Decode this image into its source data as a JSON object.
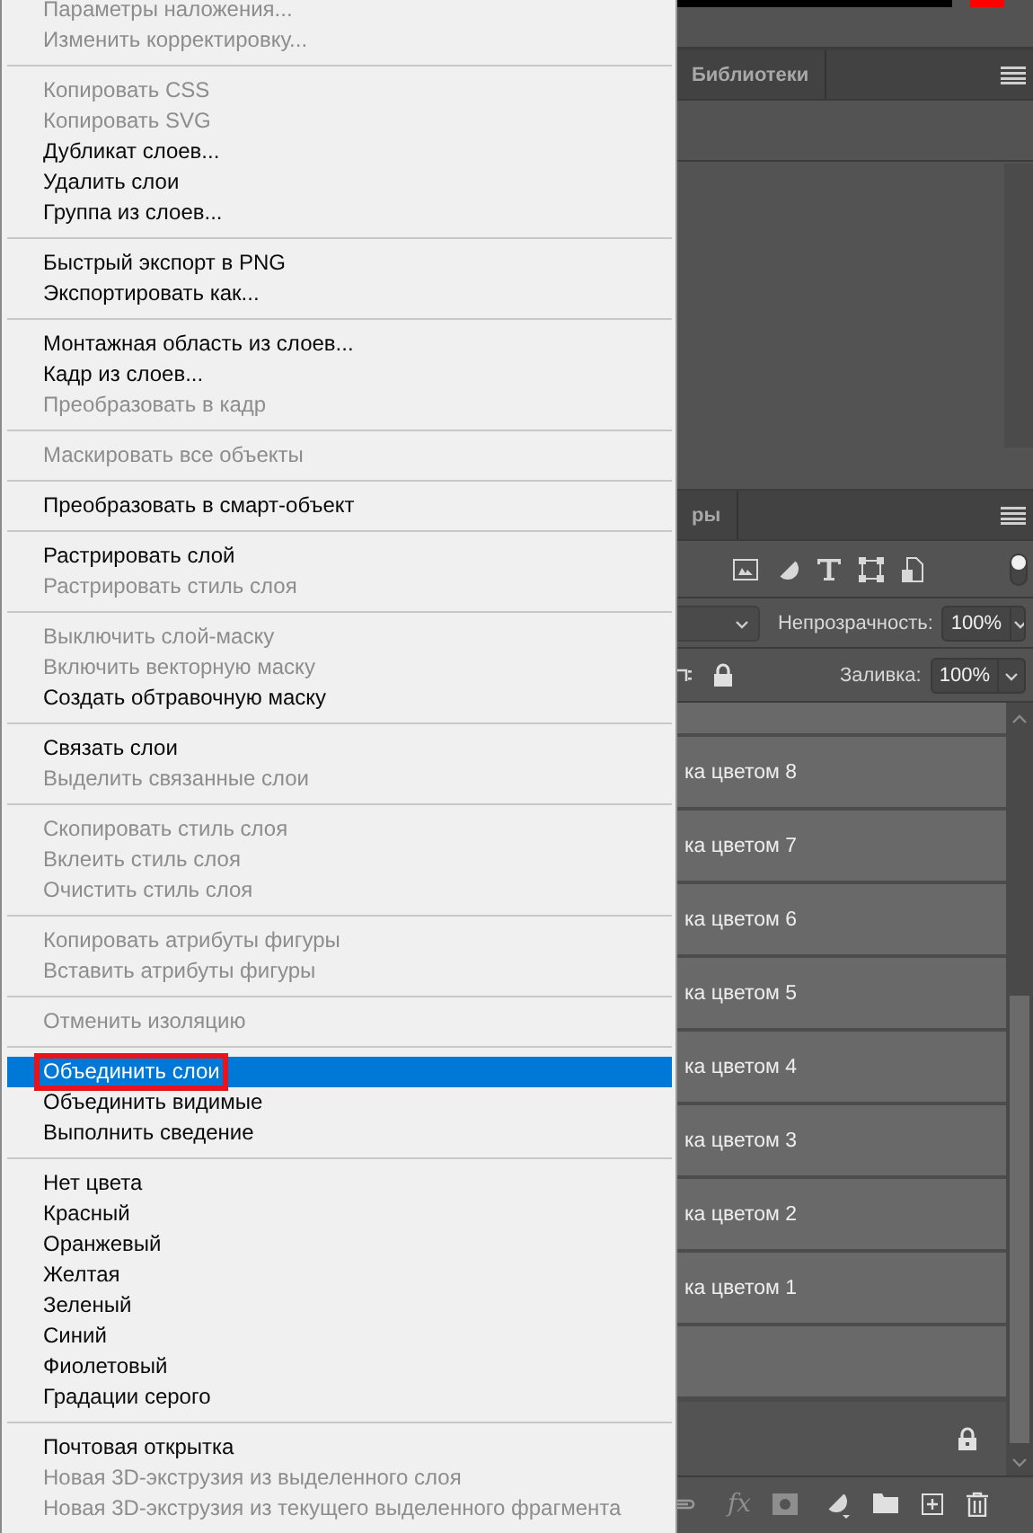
{
  "menu": {
    "groups": [
      {
        "items": [
          {
            "label": "Параметры наложения...",
            "disabled": true,
            "selected": false,
            "marked": false
          },
          {
            "label": "Изменить корректировку...",
            "disabled": true,
            "selected": false,
            "marked": false
          }
        ]
      },
      {
        "items": [
          {
            "label": "Копировать CSS",
            "disabled": true,
            "selected": false,
            "marked": false
          },
          {
            "label": "Копировать SVG",
            "disabled": true,
            "selected": false,
            "marked": false
          },
          {
            "label": "Дубликат слоев...",
            "disabled": false,
            "selected": false,
            "marked": false
          },
          {
            "label": "Удалить слои",
            "disabled": false,
            "selected": false,
            "marked": false
          },
          {
            "label": "Группа из слоев...",
            "disabled": false,
            "selected": false,
            "marked": false
          }
        ]
      },
      {
        "items": [
          {
            "label": "Быстрый экспорт в PNG",
            "disabled": false,
            "selected": false,
            "marked": false
          },
          {
            "label": "Экспортировать как...",
            "disabled": false,
            "selected": false,
            "marked": false
          }
        ]
      },
      {
        "items": [
          {
            "label": "Монтажная область из слоев...",
            "disabled": false,
            "selected": false,
            "marked": false
          },
          {
            "label": "Кадр из слоев...",
            "disabled": false,
            "selected": false,
            "marked": false
          },
          {
            "label": "Преобразовать в кадр",
            "disabled": true,
            "selected": false,
            "marked": false
          }
        ]
      },
      {
        "items": [
          {
            "label": "Маскировать все объекты",
            "disabled": true,
            "selected": false,
            "marked": false
          }
        ]
      },
      {
        "items": [
          {
            "label": "Преобразовать в смарт-объект",
            "disabled": false,
            "selected": false,
            "marked": false
          }
        ]
      },
      {
        "items": [
          {
            "label": "Растрировать слой",
            "disabled": false,
            "selected": false,
            "marked": false
          },
          {
            "label": "Растрировать стиль слоя",
            "disabled": true,
            "selected": false,
            "marked": false
          }
        ]
      },
      {
        "items": [
          {
            "label": "Выключить слой-маску",
            "disabled": true,
            "selected": false,
            "marked": false
          },
          {
            "label": "Включить векторную маску",
            "disabled": true,
            "selected": false,
            "marked": false
          },
          {
            "label": "Создать обтравочную маску",
            "disabled": false,
            "selected": false,
            "marked": false
          }
        ]
      },
      {
        "items": [
          {
            "label": "Связать слои",
            "disabled": false,
            "selected": false,
            "marked": false
          },
          {
            "label": "Выделить связанные слои",
            "disabled": true,
            "selected": false,
            "marked": false
          }
        ]
      },
      {
        "items": [
          {
            "label": "Скопировать стиль слоя",
            "disabled": true,
            "selected": false,
            "marked": false
          },
          {
            "label": "Вклеить стиль слоя",
            "disabled": true,
            "selected": false,
            "marked": false
          },
          {
            "label": "Очистить стиль слоя",
            "disabled": true,
            "selected": false,
            "marked": false
          }
        ]
      },
      {
        "items": [
          {
            "label": "Копировать атрибуты фигуры",
            "disabled": true,
            "selected": false,
            "marked": false
          },
          {
            "label": "Вставить атрибуты фигуры",
            "disabled": true,
            "selected": false,
            "marked": false
          }
        ]
      },
      {
        "items": [
          {
            "label": "Отменить изоляцию",
            "disabled": true,
            "selected": false,
            "marked": false
          }
        ]
      },
      {
        "items": [
          {
            "label": "Объединить слои",
            "disabled": false,
            "selected": true,
            "marked": true
          },
          {
            "label": "Объединить видимые",
            "disabled": false,
            "selected": false,
            "marked": false
          },
          {
            "label": "Выполнить сведение",
            "disabled": false,
            "selected": false,
            "marked": false
          }
        ]
      },
      {
        "items": [
          {
            "label": "Нет цвета",
            "disabled": false,
            "selected": false,
            "marked": false
          },
          {
            "label": "Красный",
            "disabled": false,
            "selected": false,
            "marked": false
          },
          {
            "label": "Оранжевый",
            "disabled": false,
            "selected": false,
            "marked": false
          },
          {
            "label": "Желтая",
            "disabled": false,
            "selected": false,
            "marked": false
          },
          {
            "label": "Зеленый",
            "disabled": false,
            "selected": false,
            "marked": false
          },
          {
            "label": "Синий",
            "disabled": false,
            "selected": false,
            "marked": false
          },
          {
            "label": "Фиолетовый",
            "disabled": false,
            "selected": false,
            "marked": false
          },
          {
            "label": "Градации серого",
            "disabled": false,
            "selected": false,
            "marked": false
          }
        ]
      },
      {
        "items": [
          {
            "label": "Почтовая открытка",
            "disabled": false,
            "selected": false,
            "marked": false
          },
          {
            "label": "Новая 3D-экструзия из выделенного слоя",
            "disabled": true,
            "selected": false,
            "marked": false
          },
          {
            "label": "Новая 3D-экструзия из текущего выделенного фрагмента",
            "disabled": true,
            "selected": false,
            "marked": false
          }
        ]
      }
    ]
  },
  "upper_panel": {
    "tabs": [
      {
        "label": "Библиотеки"
      }
    ]
  },
  "layers_panel": {
    "tabs": [
      {
        "label": "ры"
      }
    ],
    "opacity": {
      "label": "Непрозрачность:",
      "value": "100%"
    },
    "fill": {
      "label": "Заливка:",
      "value": "100%"
    },
    "layers": [
      "ка цветом 8",
      "ка цветом 7",
      "ка цветом 6",
      "ка цветом 5",
      "ка цветом 4",
      "ка цветом 3",
      "ка цветом 2",
      "ка цветом 1"
    ],
    "fx": "fx"
  }
}
